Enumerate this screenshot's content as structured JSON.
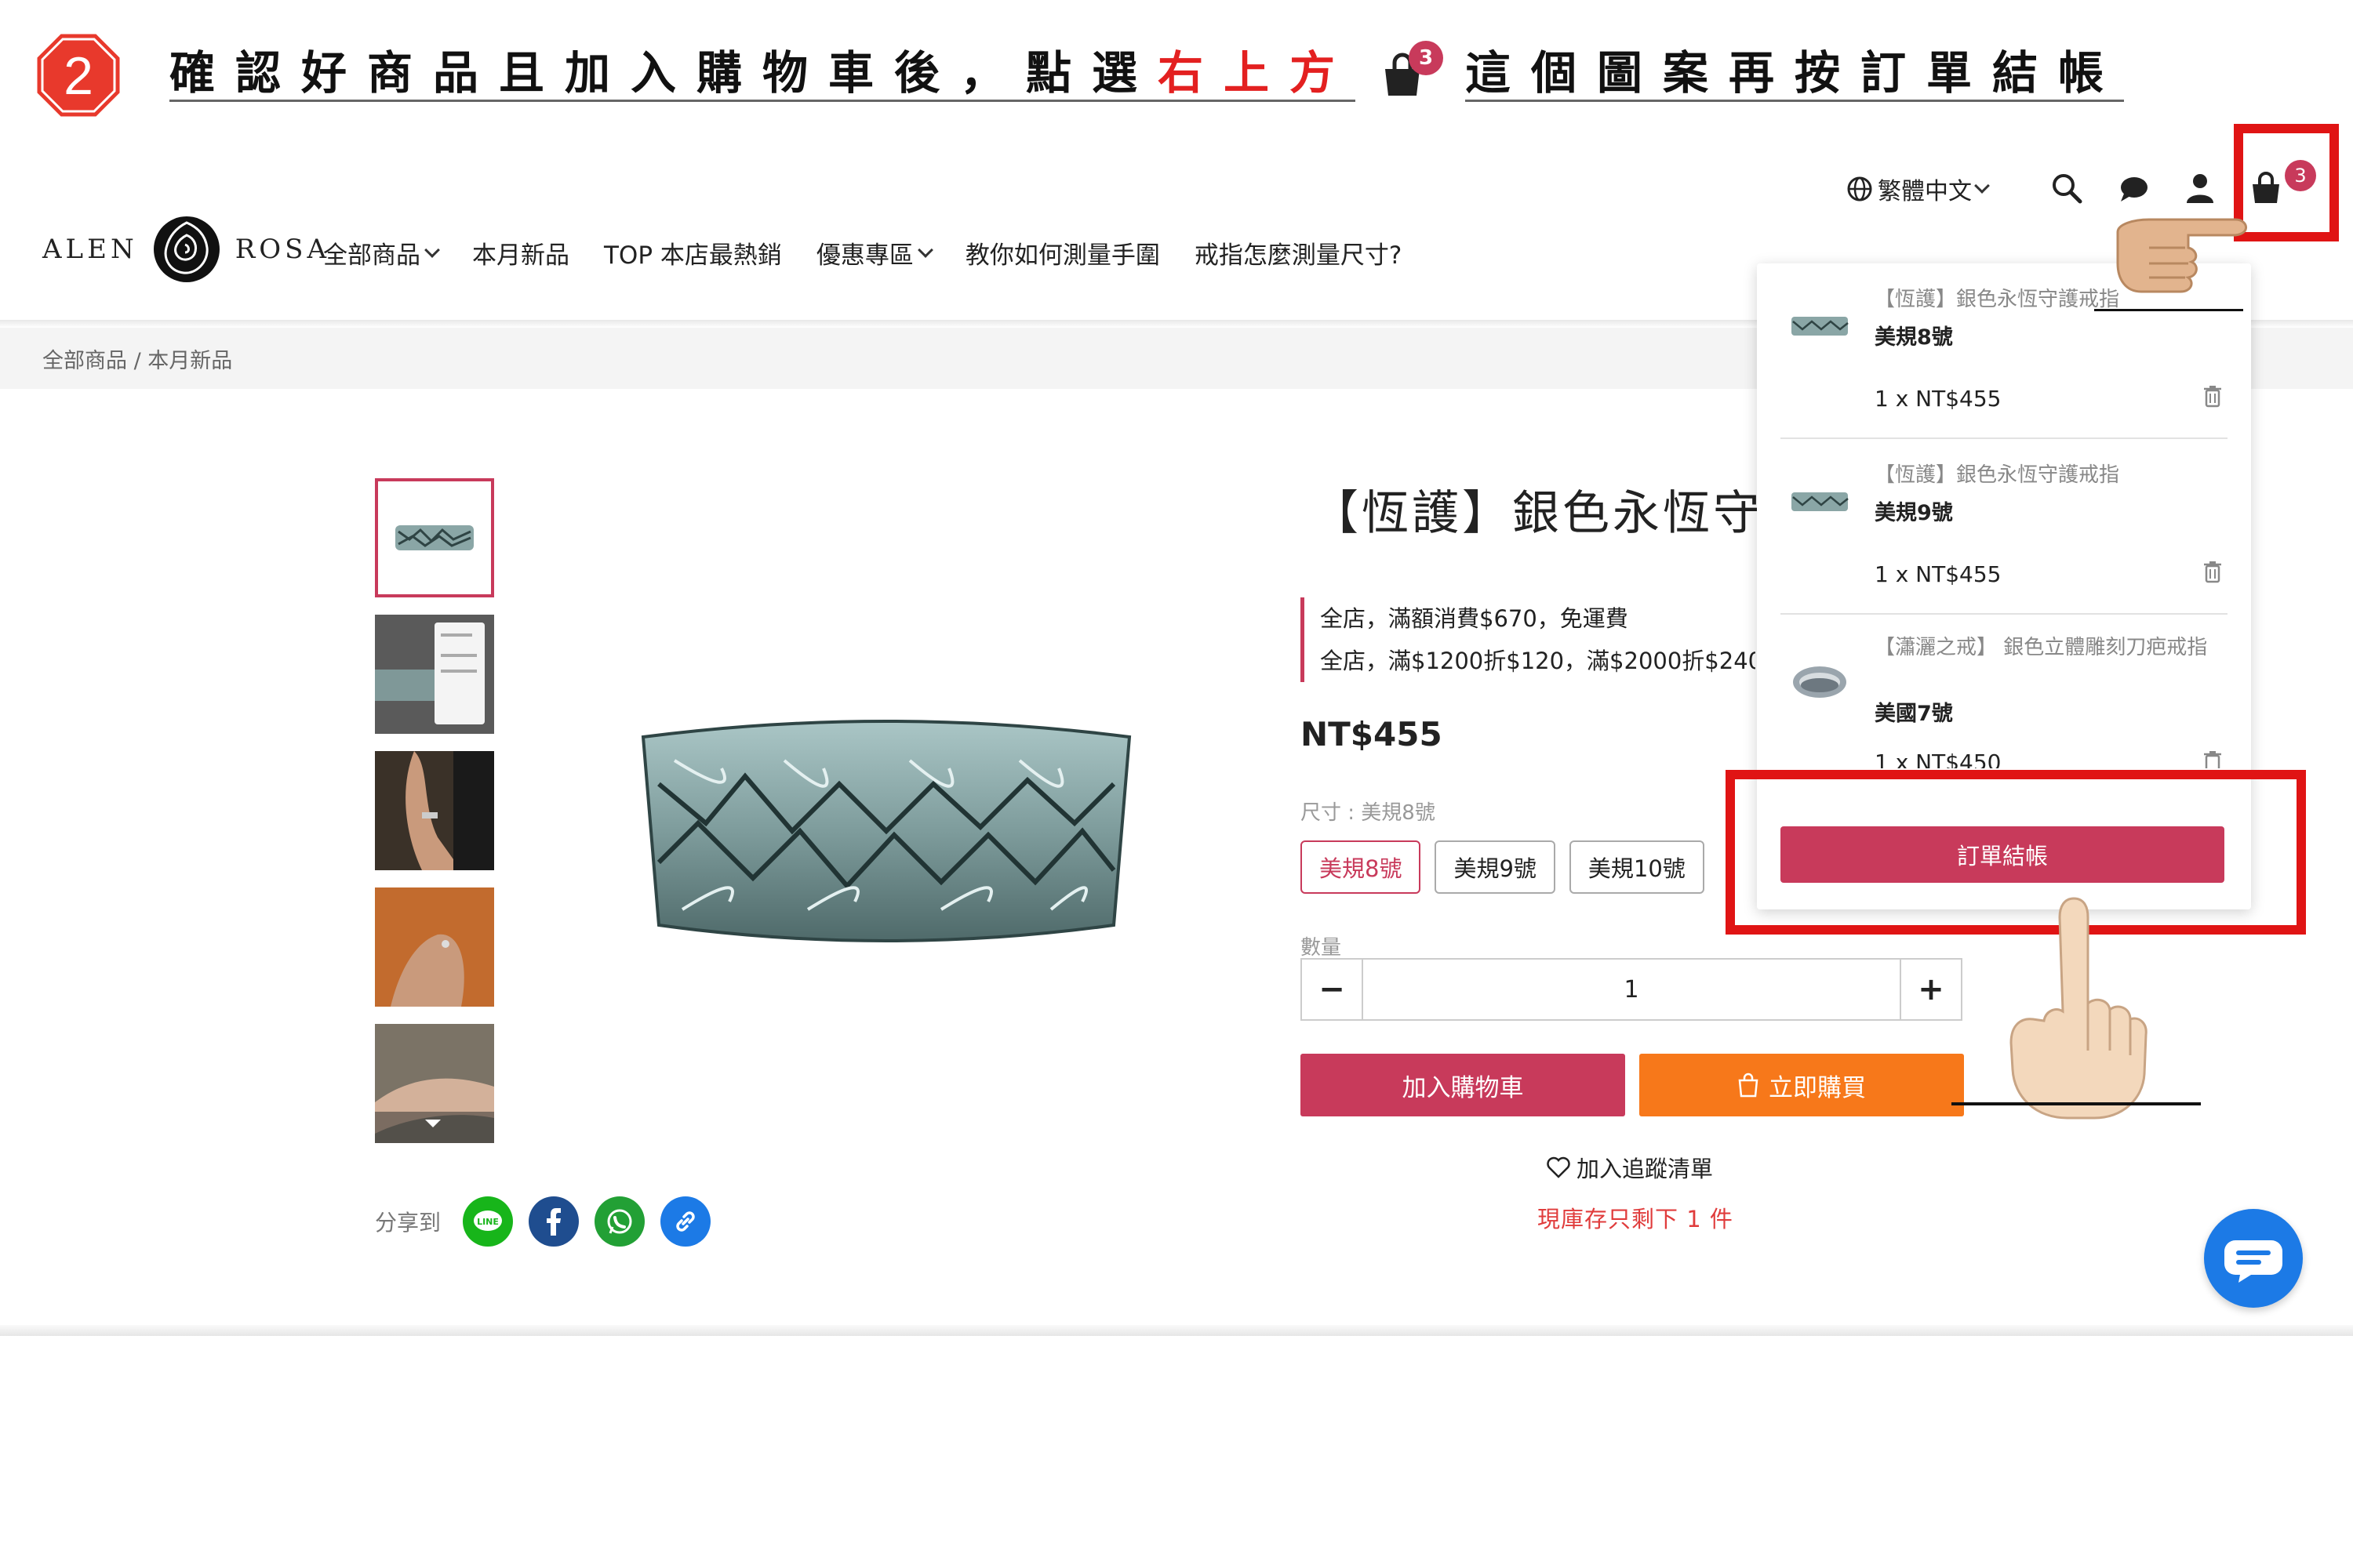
{
  "step": {
    "number": "2"
  },
  "instruction": {
    "part1": "確認好商品且加入購物車後，點選",
    "highlight": "右上方",
    "bag_count": "3",
    "part2": "這個圖案再按訂單結帳"
  },
  "header": {
    "language": "繁體中文",
    "cart_count": "3",
    "logo_left": "ALEN",
    "logo_right": "ROSA",
    "nav": [
      "全部商品",
      "本月新品",
      "TOP 本店最熱銷",
      "優惠專區",
      "教你如何測量手圍",
      "戒指怎麼測量尺寸?"
    ]
  },
  "breadcrumb": "全部商品 / 本月新品",
  "share": {
    "label": "分享到"
  },
  "product": {
    "title": "【恆護】銀色永恆守護戒指",
    "promos": [
      "全店，滿額消費$670，免運費",
      "全店，滿$1200折$120，滿$2000折$240，"
    ],
    "price": "NT$455",
    "size_label": "尺寸 : 美規8號",
    "sizes": [
      "美規8號",
      "美規9號",
      "美規10號"
    ],
    "quantity_label": "數量",
    "quantity": "1",
    "add_to_cart": "加入購物車",
    "buy_now": "立即購買",
    "wishlist": "加入追蹤清單",
    "stock": "現庫存只剩下 1 件"
  },
  "cart": {
    "items": [
      {
        "name": "【恆護】銀色永恆守護戒指",
        "variant": "美規8號",
        "line": "1 x  NT$455"
      },
      {
        "name": "【恆護】銀色永恆守護戒指",
        "variant": "美規9號",
        "line": "1 x  NT$455"
      },
      {
        "name": "【瀟灑之戒】 銀色立體雕刻刀疤戒指",
        "variant": "美國7號",
        "line": "1 x  NT$450"
      }
    ],
    "checkout": "訂單結帳"
  },
  "colors": {
    "accent": "#c83a5b",
    "buy": "#f7781a",
    "annotation": "#e01414",
    "chat": "#1c7ae6"
  }
}
